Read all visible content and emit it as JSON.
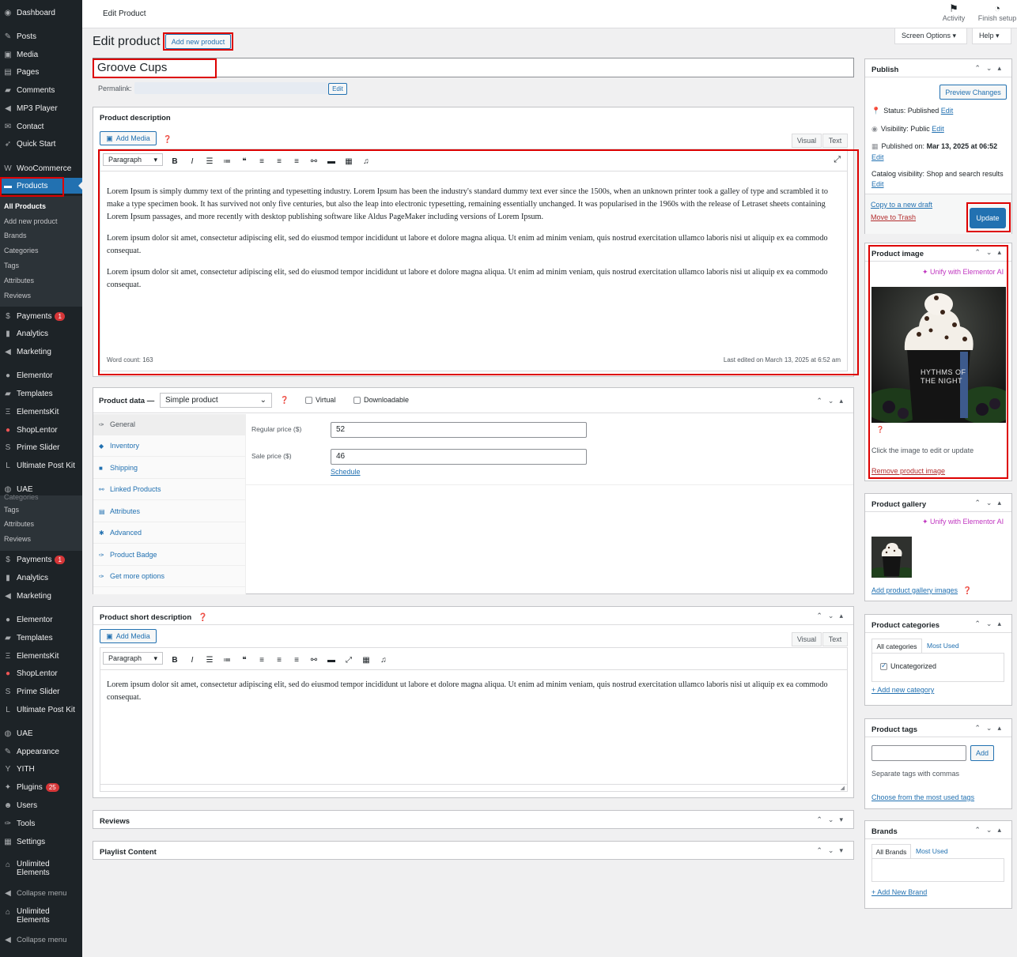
{
  "sidebar": {
    "top_items": [
      {
        "label": "Dashboard",
        "icon": "dashboard-icon"
      },
      {
        "label": "Posts",
        "icon": "pin-icon"
      },
      {
        "label": "Media",
        "icon": "media-icon"
      },
      {
        "label": "Pages",
        "icon": "pages-icon"
      },
      {
        "label": "Comments",
        "icon": "comments-icon"
      },
      {
        "label": "MP3 Player",
        "icon": "music-icon"
      },
      {
        "label": "Contact",
        "icon": "mail-icon"
      },
      {
        "label": "Quick Start",
        "icon": "rocket-icon"
      },
      {
        "label": "WooCommerce",
        "icon": "woo-icon"
      },
      {
        "label": "Products",
        "icon": "products-icon"
      }
    ],
    "products_sub": [
      "All Products",
      "Add new product",
      "Brands",
      "Categories",
      "Tags",
      "Attributes",
      "Reviews"
    ],
    "mid_items": [
      {
        "label": "Payments",
        "icon": "payments-icon",
        "badge": "1"
      },
      {
        "label": "Analytics",
        "icon": "analytics-icon"
      },
      {
        "label": "Marketing",
        "icon": "megaphone-icon"
      },
      {
        "label": "Elementor",
        "icon": "elementor-icon"
      },
      {
        "label": "Templates",
        "icon": "folder-icon"
      },
      {
        "label": "ElementsKit",
        "icon": "ek-icon"
      },
      {
        "label": "ShopLentor",
        "icon": "shoplentor-icon"
      },
      {
        "label": "Prime Slider",
        "icon": "slider-icon"
      },
      {
        "label": "Ultimate Post Kit",
        "icon": "upk-icon"
      },
      {
        "label": "UAE",
        "icon": "uae-icon"
      }
    ],
    "dup_sub": [
      "Categories",
      "Tags",
      "Attributes",
      "Reviews"
    ],
    "lower_items": [
      {
        "label": "Payments",
        "icon": "payments-icon",
        "badge": "1"
      },
      {
        "label": "Analytics",
        "icon": "analytics-icon"
      },
      {
        "label": "Marketing",
        "icon": "megaphone-icon"
      },
      {
        "label": "Elementor",
        "icon": "elementor-icon"
      },
      {
        "label": "Templates",
        "icon": "folder-icon"
      },
      {
        "label": "ElementsKit",
        "icon": "ek-icon"
      },
      {
        "label": "ShopLentor",
        "icon": "shoplentor-icon"
      },
      {
        "label": "Prime Slider",
        "icon": "slider-icon"
      },
      {
        "label": "Ultimate Post Kit",
        "icon": "upk-icon"
      },
      {
        "label": "UAE",
        "icon": "uae-icon"
      },
      {
        "label": "Appearance",
        "icon": "brush-icon"
      },
      {
        "label": "YITH",
        "icon": "yith-icon"
      },
      {
        "label": "Plugins",
        "icon": "plug-icon",
        "badge": "25"
      },
      {
        "label": "Users",
        "icon": "users-icon"
      },
      {
        "label": "Tools",
        "icon": "wrench-icon"
      },
      {
        "label": "Settings",
        "icon": "settings-icon"
      }
    ],
    "unlimited": "Unlimited Elements",
    "collapse": "Collapse menu"
  },
  "topbar": {
    "page_title": "Edit Product",
    "activity": "Activity",
    "finish_setup": "Finish setup",
    "screen_options": "Screen Options ▾",
    "help": "Help ▾"
  },
  "heading": {
    "title": "Edit product",
    "add_new": "Add new product"
  },
  "post": {
    "title": "Groove Cups",
    "permalink_label": "Permalink:",
    "permalink_edit": "Edit"
  },
  "description_box": {
    "title": "Product description",
    "add_media": "Add Media",
    "tab_visual": "Visual",
    "tab_text": "Text",
    "format": "Paragraph",
    "paragraphs": [
      "Lorem Ipsum is simply dummy text of the printing and typesetting industry. Lorem Ipsum has been the industry's standard dummy text ever since the 1500s, when an unknown printer took a galley of type and scrambled it to make a type specimen book. It has survived not only five centuries, but also the leap into electronic typesetting, remaining essentially unchanged. It was popularised in the 1960s with the release of Letraset sheets containing Lorem Ipsum passages, and more recently with desktop publishing software like Aldus PageMaker including versions of Lorem Ipsum.",
      "Lorem ipsum dolor sit amet, consectetur adipiscing elit, sed do eiusmod tempor incididunt ut labore et dolore magna aliqua. Ut enim ad minim veniam, quis nostrud exercitation ullamco laboris nisi ut aliquip ex ea commodo consequat.",
      "Lorem ipsum dolor sit amet, consectetur adipiscing elit, sed do eiusmod tempor incididunt ut labore et dolore magna aliqua. Ut enim ad minim veniam, quis nostrud exercitation ullamco laboris nisi ut aliquip ex ea commodo consequat."
    ],
    "word_count": "Word count: 163",
    "last_edited": "Last edited on March 13, 2025 at 6:52 am"
  },
  "product_data": {
    "label": "Product data —",
    "type": "Simple product",
    "virtual": "Virtual",
    "downloadable": "Downloadable",
    "tabs": [
      "General",
      "Inventory",
      "Shipping",
      "Linked Products",
      "Attributes",
      "Advanced",
      "Product Badge",
      "Get more options"
    ],
    "regular_price_label": "Regular price ($)",
    "regular_price": "52",
    "sale_price_label": "Sale price ($)",
    "sale_price": "46",
    "schedule": "Schedule"
  },
  "short_desc": {
    "title": "Product short description",
    "add_media": "Add Media",
    "tab_visual": "Visual",
    "tab_text": "Text",
    "format": "Paragraph",
    "text": "Lorem ipsum dolor sit amet, consectetur adipiscing elit, sed do eiusmod tempor incididunt ut labore et dolore magna aliqua. Ut enim ad minim veniam, quis nostrud exercitation ullamco laboris nisi ut aliquip ex ea commodo consequat."
  },
  "reviews_box": {
    "title": "Reviews"
  },
  "playlist_box": {
    "title": "Playlist Content"
  },
  "publish": {
    "title": "Publish",
    "preview": "Preview Changes",
    "status": "Status: Published",
    "visibility": "Visibility: Public",
    "published_label": "Published on:",
    "published_on": "Mar 13, 2025 at 06:52",
    "catalog": "Catalog visibility: Shop and search results",
    "edit": "Edit",
    "copy_draft": "Copy to a new draft",
    "trash": "Move to Trash",
    "update": "Update"
  },
  "product_image": {
    "title": "Product image",
    "unify": "Unify with Elementor AI",
    "cup_text_1": "HYTHMS OF",
    "cup_text_2": "THE NIGHT",
    "hint": "Click the image to edit or update",
    "remove": "Remove product image"
  },
  "gallery": {
    "title": "Product gallery",
    "unify": "Unify with Elementor AI",
    "add": "Add product gallery images"
  },
  "categories": {
    "title": "Product categories",
    "tab_all": "All categories",
    "tab_used": "Most Used",
    "item": "Uncategorized",
    "add": "+ Add new category"
  },
  "tags": {
    "title": "Product tags",
    "add": "Add",
    "hint": "Separate tags with commas",
    "choose": "Choose from the most used tags"
  },
  "brands": {
    "title": "Brands",
    "tab_all": "All Brands",
    "tab_used": "Most Used",
    "add": "+ Add New Brand"
  },
  "colors": {
    "sidebar_bg": "#1d2327",
    "accent": "#2271b1",
    "highlight": "#dd0000"
  }
}
